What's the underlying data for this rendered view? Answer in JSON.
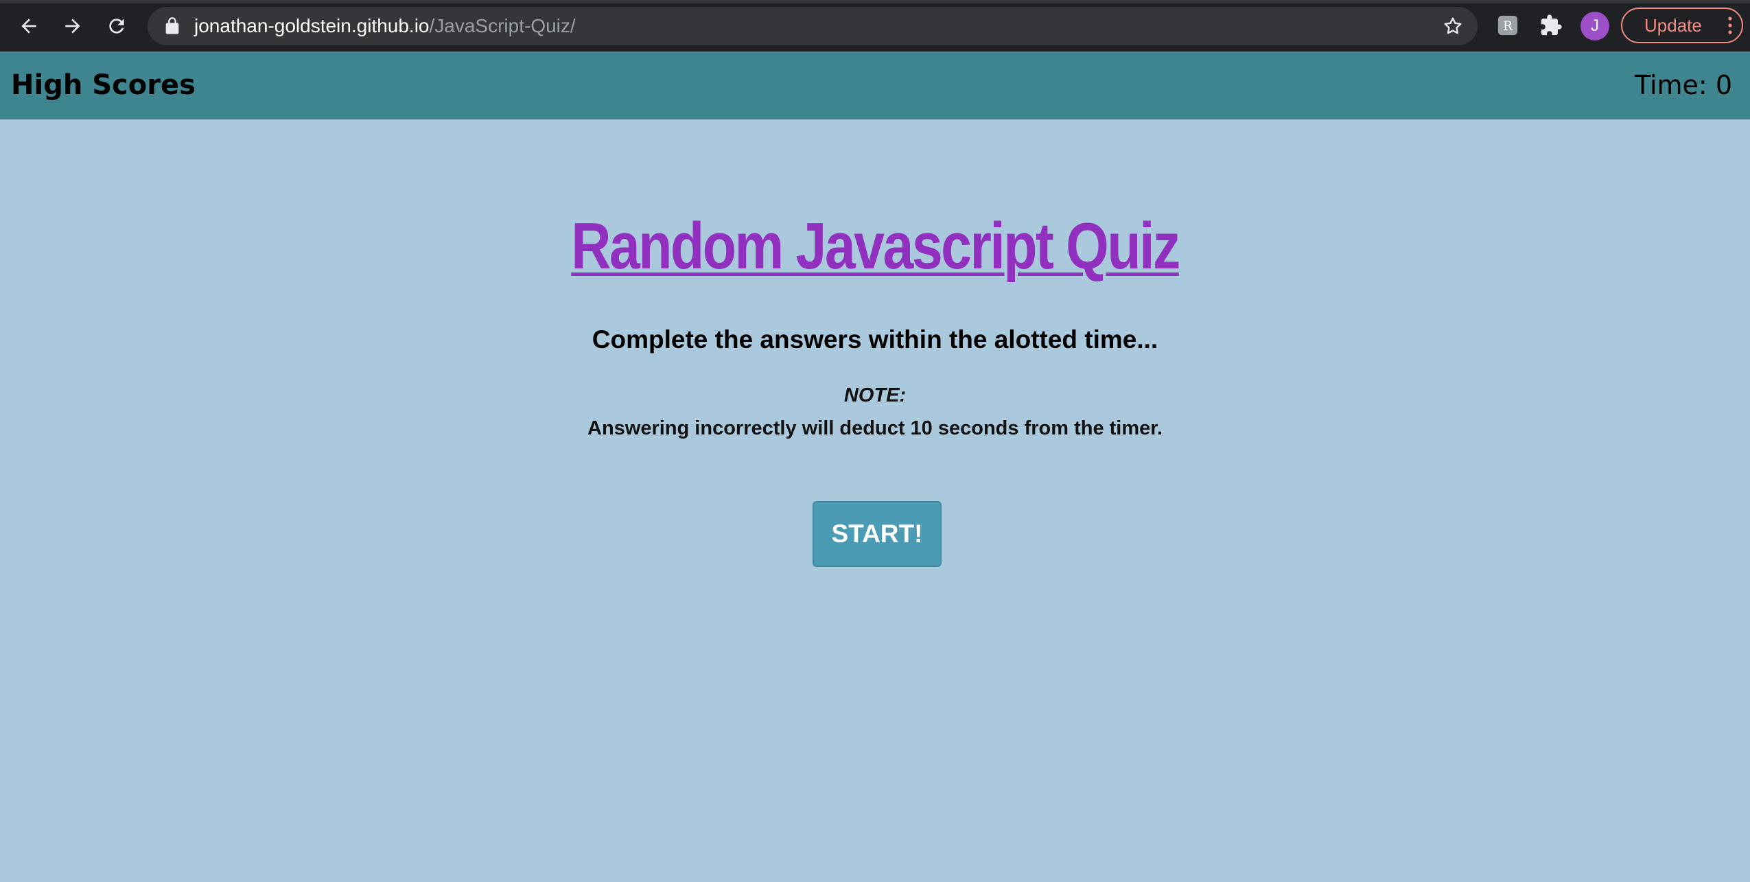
{
  "browser": {
    "url_host": "jonathan-goldstein.github.io",
    "url_path": "/JavaScript-Quiz/",
    "profile_initial": "J",
    "update_label": "Update",
    "icons": [
      "back-arrow-icon",
      "forward-arrow-icon",
      "reload-icon",
      "lock-icon",
      "star-icon",
      "extension-icon",
      "puzzle-icon",
      "menu-dots-icon"
    ]
  },
  "header": {
    "high_scores_label": "High Scores",
    "timer_text": "Time: 0"
  },
  "main": {
    "title": "Random Javascript Quiz",
    "subtitle": "Complete the answers within the alotted time...",
    "note_label": "NOTE:",
    "note_text": "Answering incorrectly will deduct 10 seconds from the timer.",
    "start_label": "START!"
  },
  "colors": {
    "page_background": "#abc9dd",
    "header_background": "#3f8590",
    "title_color": "#9130be",
    "button_background": "#4a9bb3",
    "browser_chrome": "#202124"
  }
}
